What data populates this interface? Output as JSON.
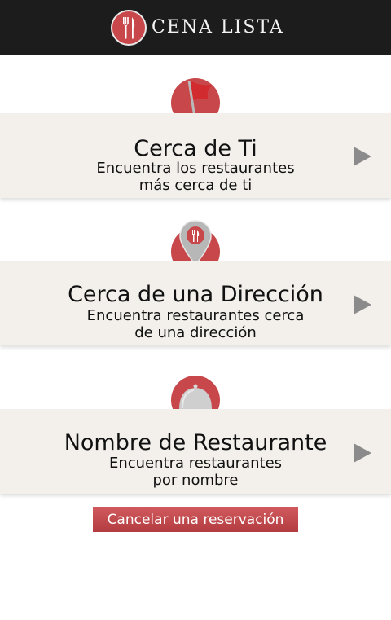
{
  "app": {
    "brand_name": "CENA LISTA"
  },
  "options": [
    {
      "title": "Cerca de Ti",
      "subtitle_line1": "Encuentra los restaurantes",
      "subtitle_line2": "más cerca de ti",
      "icon": "flag-icon"
    },
    {
      "title": "Cerca de una Dirección",
      "subtitle_line1": "Encuentra restaurantes cerca",
      "subtitle_line2": "de una dirección",
      "icon": "map-pin-icon"
    },
    {
      "title": "Nombre de Restaurante",
      "subtitle_line1": "Encuentra restaurantes",
      "subtitle_line2": "por nombre",
      "icon": "cloche-icon"
    }
  ],
  "cancel_button": {
    "label": "Cancelar una reservación"
  },
  "colors": {
    "accent": "#c8474a",
    "topbar": "#1c1c1c",
    "card": "#f3f0ec",
    "arrow": "#8b8b8b"
  }
}
